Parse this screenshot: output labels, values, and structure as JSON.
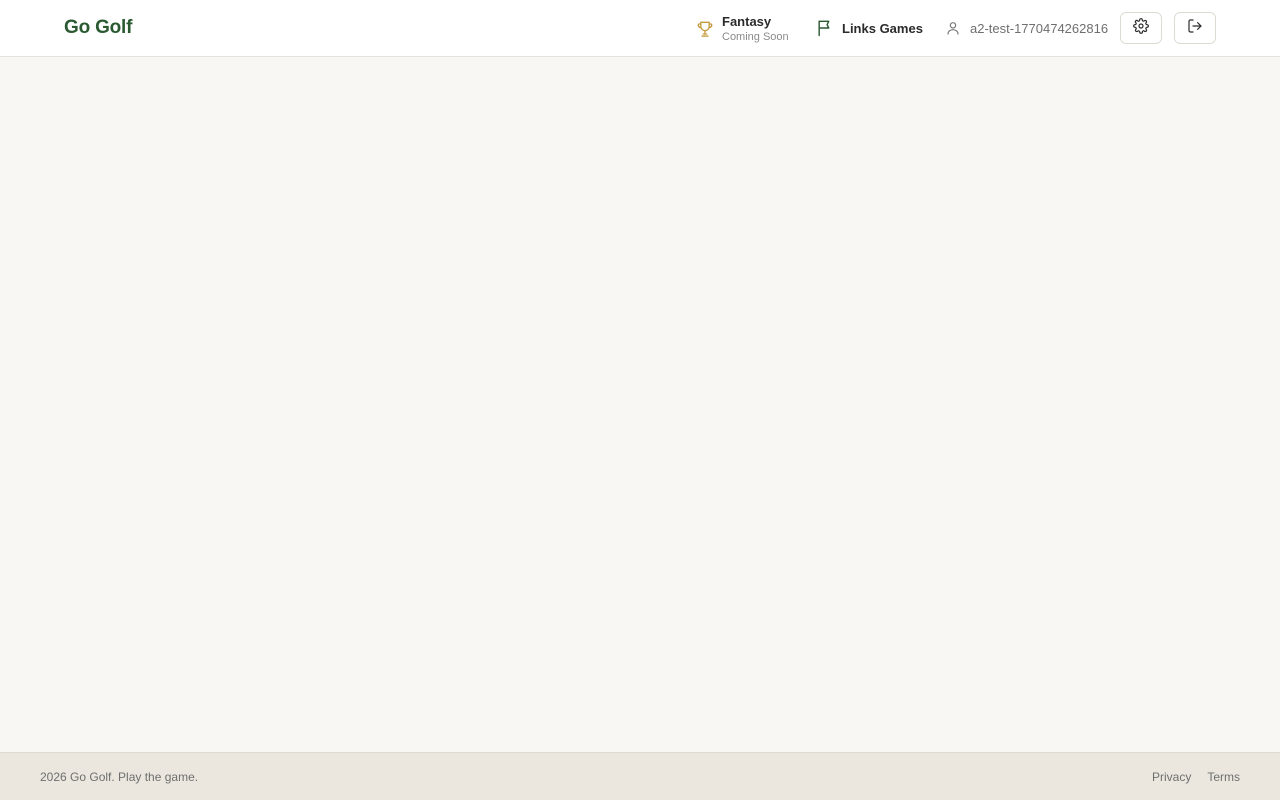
{
  "header": {
    "brand": "Go Golf",
    "nav": {
      "fantasy": {
        "title": "Fantasy",
        "subtitle": "Coming Soon",
        "icon": "trophy-icon"
      },
      "links_games": {
        "label": "Links Games",
        "icon": "flag-icon"
      }
    },
    "user": {
      "username": "a2-test-1770474262816",
      "icon": "user-icon"
    },
    "actions": {
      "settings_icon": "gear-icon",
      "logout_icon": "logout-icon"
    }
  },
  "footer": {
    "copyright": "2026 Go Golf. Play the game.",
    "links": [
      "Privacy",
      "Terms"
    ]
  },
  "colors": {
    "brand": "#2b5a32",
    "accent_gold": "#c49a3c",
    "background": "#f8f7f3",
    "footer_background": "#ebe7de"
  }
}
